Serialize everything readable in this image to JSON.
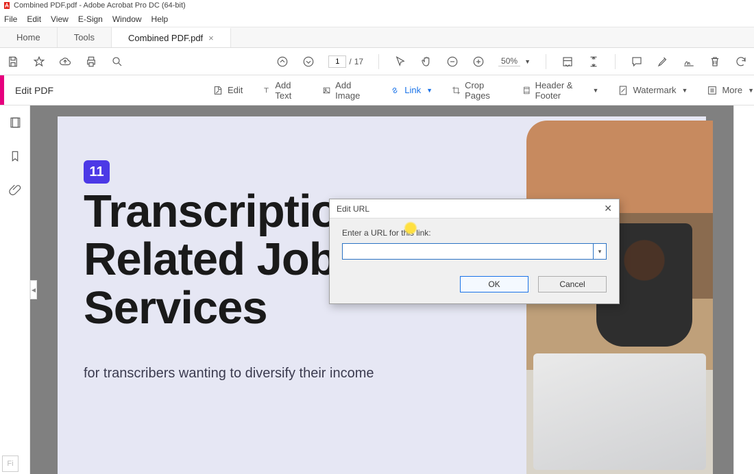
{
  "titlebar": {
    "text": "Combined PDF.pdf - Adobe Acrobat Pro DC (64-bit)"
  },
  "menubar": {
    "items": [
      "File",
      "Edit",
      "View",
      "E-Sign",
      "Window",
      "Help"
    ]
  },
  "tabs": {
    "home": "Home",
    "tools": "Tools",
    "doc": "Combined PDF.pdf"
  },
  "toolbar": {
    "page_current": "1",
    "page_sep": "/",
    "page_total": "17",
    "zoom": "50%"
  },
  "editbar": {
    "title": "Edit PDF",
    "edit": "Edit",
    "add_text": "Add Text",
    "add_image": "Add Image",
    "link": "Link",
    "crop": "Crop Pages",
    "header_footer": "Header & Footer",
    "watermark": "Watermark",
    "more": "More"
  },
  "document": {
    "badge": "11",
    "title_line1": "Transcription-",
    "title_line2": "Related Jobs &",
    "title_line3": "Services",
    "subtitle": "for transcribers wanting to diversify their income"
  },
  "dialog": {
    "title": "Edit URL",
    "label": "Enter a URL for this link:",
    "value": "",
    "ok": "OK",
    "cancel": "Cancel"
  },
  "misc": {
    "fi": "Fi"
  }
}
